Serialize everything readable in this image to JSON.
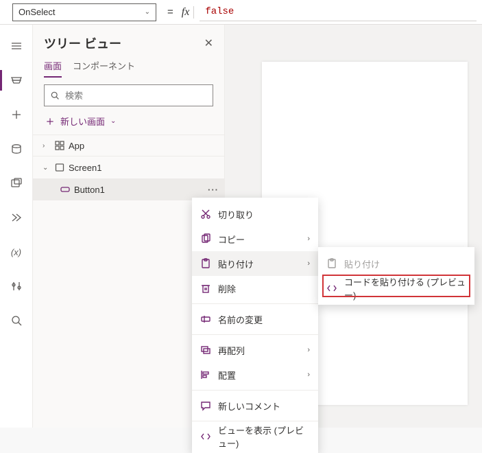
{
  "formula": {
    "property": "OnSelect",
    "value": "false"
  },
  "treeview": {
    "title": "ツリー ビュー",
    "tabs": {
      "screen": "画面",
      "components": "コンポーネント"
    },
    "search_placeholder": "検索",
    "new_screen": "新しい画面",
    "app": "App",
    "screen1": "Screen1",
    "button1": "Button1"
  },
  "context_menu": {
    "cut": "切り取り",
    "copy": "コピー",
    "paste": "貼り付け",
    "delete": "削除",
    "rename": "名前の変更",
    "reorder": "再配列",
    "align": "配置",
    "new_comment": "新しいコメント",
    "show_view": "ビューを表示 (プレビュー)"
  },
  "paste_submenu": {
    "paste": "貼り付け",
    "paste_code": "コードを貼り付ける (プレビュー)"
  }
}
